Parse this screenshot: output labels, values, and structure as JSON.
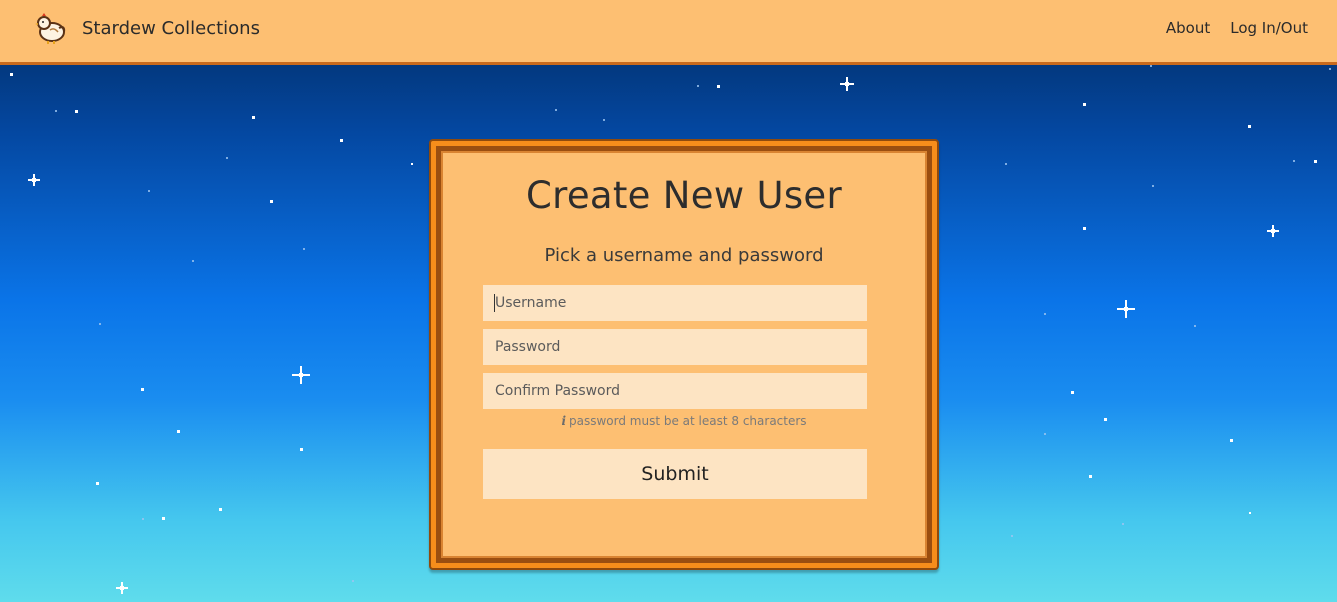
{
  "app": {
    "name": "Stardew Collections"
  },
  "nav": {
    "about": "About",
    "login": "Log In/Out"
  },
  "form": {
    "title": "Create New User",
    "subtitle": "Pick a username and password",
    "username_placeholder": "Username",
    "password_placeholder": "Password",
    "confirm_placeholder": "Confirm Password",
    "hint_icon": "i",
    "hint": "password must be at least 8 characters",
    "submit_label": "Submit"
  },
  "colors": {
    "navbar": "#fdbf72",
    "card_border": "#f68d1b",
    "field_bg": "#fde4c3",
    "sky_top": "#022a5e",
    "sky_bottom": "#5fdcec"
  },
  "icons": {
    "logo": "chicken-icon",
    "hint": "info-icon"
  }
}
